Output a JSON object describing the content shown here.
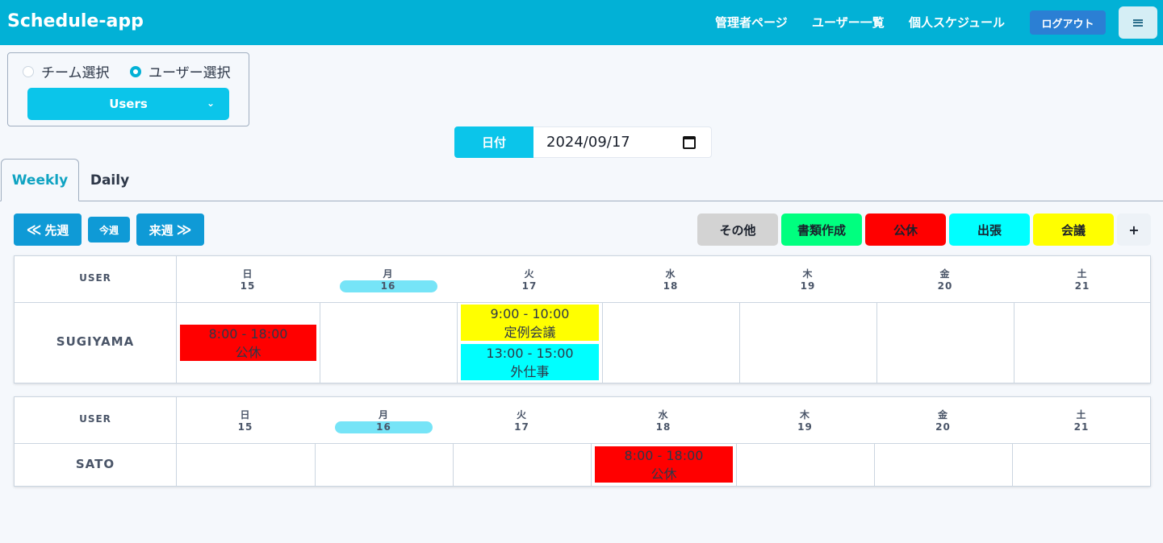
{
  "nav": {
    "brand": "Schedule-app",
    "links": [
      "管理者ページ",
      "ユーザー一覧",
      "個人スケジュール"
    ],
    "logout": "ログアウト",
    "menu_icon": "hamburger-icon"
  },
  "selector": {
    "team_label": "チーム選択",
    "user_label": "ユーザー選択",
    "selected": "user",
    "dropdown_value": "Users"
  },
  "date": {
    "label": "日付",
    "value": "2024/09/17"
  },
  "tabs": [
    "Weekly",
    "Daily"
  ],
  "active_tab": "Weekly",
  "week_nav": {
    "prev": "先週",
    "current": "今週",
    "next": "来週"
  },
  "categories": [
    {
      "label": "その他",
      "color": "#d3d3d3"
    },
    {
      "label": "書類作成",
      "color": "#00ff7f"
    },
    {
      "label": "公休",
      "color": "#ff0000"
    },
    {
      "label": "出張",
      "color": "#00ffff"
    },
    {
      "label": "会議",
      "color": "#ffff00"
    }
  ],
  "add_label": "+",
  "days": [
    {
      "dow": "日",
      "date": "15"
    },
    {
      "dow": "月",
      "date": "16"
    },
    {
      "dow": "火",
      "date": "17"
    },
    {
      "dow": "水",
      "date": "18"
    },
    {
      "dow": "木",
      "date": "19"
    },
    {
      "dow": "金",
      "date": "20"
    },
    {
      "dow": "土",
      "date": "21"
    }
  ],
  "today_index": 1,
  "user_header": "USER",
  "schedules": [
    {
      "user": "SUGIYAMA",
      "events": [
        {
          "day": 0,
          "time": "8:00 - 18:00",
          "title": "公休",
          "color": "#ff0000"
        },
        {
          "day": 2,
          "time": "9:00 - 10:00",
          "title": "定例会議",
          "color": "#ffff00"
        },
        {
          "day": 2,
          "time": "13:00 - 15:00",
          "title": "外仕事",
          "color": "#00ffff"
        }
      ]
    },
    {
      "user": "SATO",
      "events": [
        {
          "day": 3,
          "time": "8:00 - 18:00",
          "title": "公休",
          "color": "#ff0000"
        }
      ]
    }
  ]
}
